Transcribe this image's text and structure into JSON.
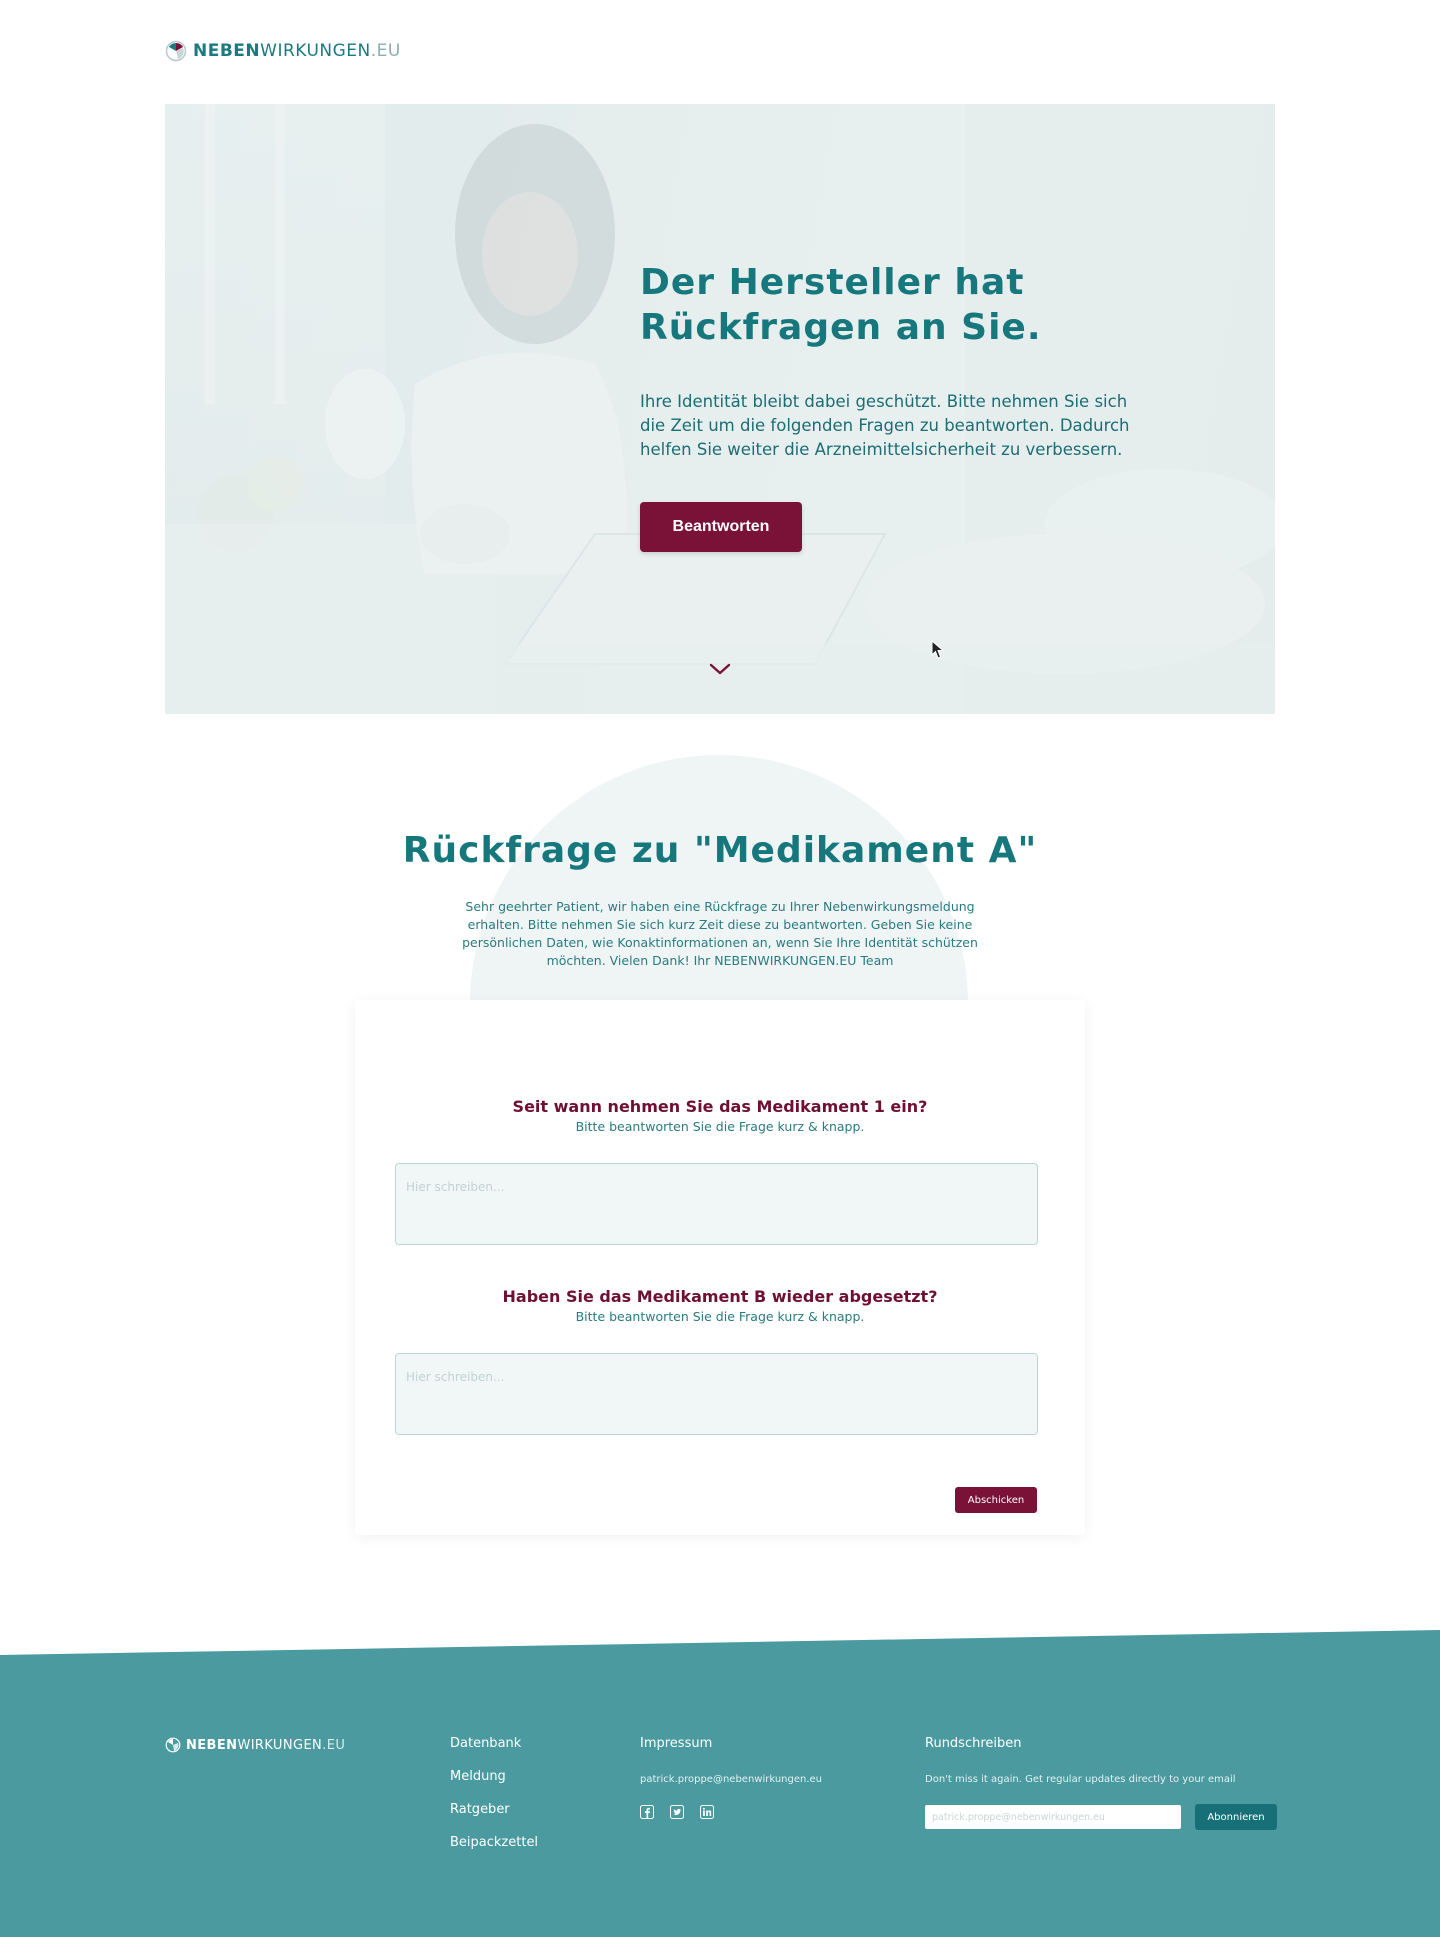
{
  "header": {
    "logo": {
      "part1": "NEBEN",
      "part2": "WIRKUNGEN",
      "part3": ".EU"
    }
  },
  "hero": {
    "title_line1": "Der Hersteller hat",
    "title_line2": "Rückfragen an Sie.",
    "text": "Ihre Identität bleibt dabei geschützt. Bitte nehmen Sie sich die Zeit um die folgenden Fragen zu beantworten. Dadurch helfen Sie weiter die Arzneimittelsicherheit zu verbessern.",
    "button_label": "Beantworten"
  },
  "section": {
    "title": "Rückfrage zu \"Medikament A\"",
    "intro": "Sehr geehrter Patient, wir haben eine Rückfrage zu Ihrer Nebenwirkungsmeldung erhalten. Bitte nehmen Sie sich kurz Zeit diese zu beantworten. Geben Sie keine persönlichen Daten, wie Konaktinformationen an, wenn Sie Ihre Identität schützen möchten. Vielen Dank! Ihr NEBENWIRKUNGEN.EU Team"
  },
  "form": {
    "questions": [
      {
        "title": "Seit wann nehmen Sie das Medikament 1 ein?",
        "hint": "Bitte beantworten Sie die Frage kurz & knapp.",
        "placeholder": "Hier schreiben..."
      },
      {
        "title": "Haben Sie das Medikament B wieder abgesetzt?",
        "hint": "Bitte beantworten Sie die Frage kurz & knapp.",
        "placeholder": "Hier schreiben..."
      }
    ],
    "submit_label": "Abschicken"
  },
  "footer": {
    "logo": {
      "part1": "NEBEN",
      "part2": "WIRKUNGEN",
      "part3": ".EU"
    },
    "links": [
      "Datenbank",
      "Meldung",
      "Ratgeber",
      "Beipackzettel"
    ],
    "impressum": {
      "heading": "Impressum",
      "email": "patrick.proppe@nebenwirkungen.eu",
      "social_icons": [
        "facebook-icon",
        "twitter-icon",
        "linkedin-icon"
      ]
    },
    "newsletter": {
      "heading": "Rundschreiben",
      "description": "Don't miss it again. Get regular updates directly to your email",
      "placeholder": "patrick.proppe@nebenwirkungen.eu",
      "button_label": "Abonnieren"
    }
  },
  "colors": {
    "primary_teal": "#16777d",
    "accent_burgundy": "#7a1238",
    "footer_teal": "#4a9aa0"
  }
}
